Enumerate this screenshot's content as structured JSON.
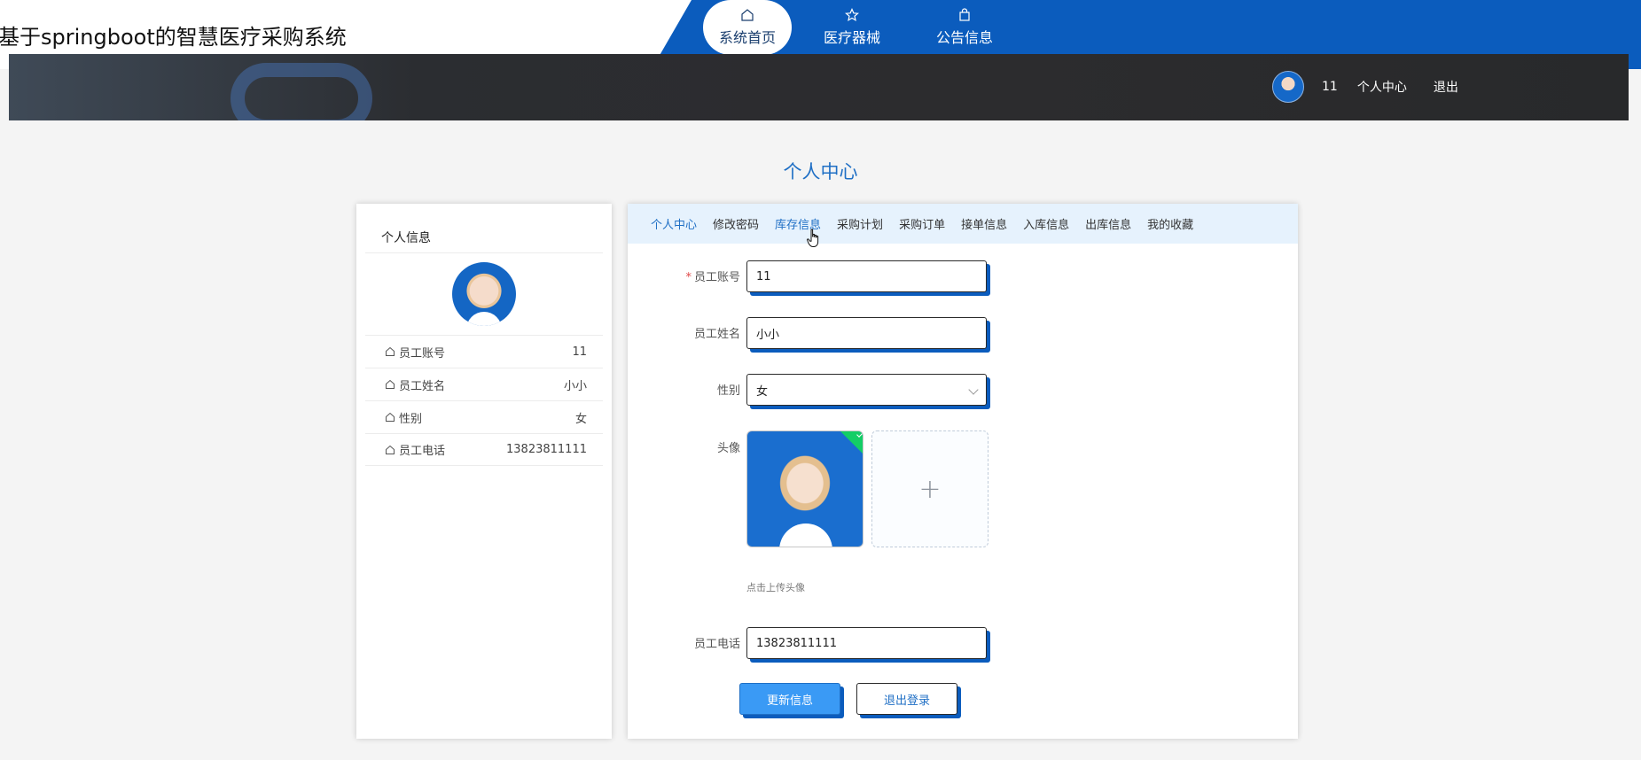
{
  "site": {
    "title": "基于springboot的智慧医疗采购系统"
  },
  "nav": {
    "items": [
      {
        "label": "系统首页",
        "icon": "home-icon"
      },
      {
        "label": "医疗器械",
        "icon": "star-icon"
      },
      {
        "label": "公告信息",
        "icon": "bag-icon"
      }
    ]
  },
  "user": {
    "name": "11",
    "center_label": "个人中心",
    "logout_label": "退出"
  },
  "page": {
    "title": "个人中心"
  },
  "left_panel": {
    "heading": "个人信息",
    "rows": [
      {
        "key": "员工账号",
        "value": "11"
      },
      {
        "key": "员工姓名",
        "value": "小小"
      },
      {
        "key": "性别",
        "value": "女"
      },
      {
        "key": "员工电话",
        "value": "13823811111"
      }
    ]
  },
  "tabs": [
    "个人中心",
    "修改密码",
    "库存信息",
    "采购计划",
    "采购订单",
    "接单信息",
    "入库信息",
    "出库信息",
    "我的收藏"
  ],
  "form": {
    "account_label": "员工账号",
    "account_value": "11",
    "name_label": "员工姓名",
    "name_value": "小小",
    "gender_label": "性别",
    "gender_value": "女",
    "avatar_label": "头像",
    "upload_tip": "点击上传头像",
    "phone_label": "员工电话",
    "phone_value": "13823811111",
    "update_button": "更新信息",
    "logout_button": "退出登录"
  },
  "colors": {
    "brand_blue": "#0b5cbd",
    "accent": "#1f6fc5",
    "tab_bg": "#e6f2fd"
  }
}
